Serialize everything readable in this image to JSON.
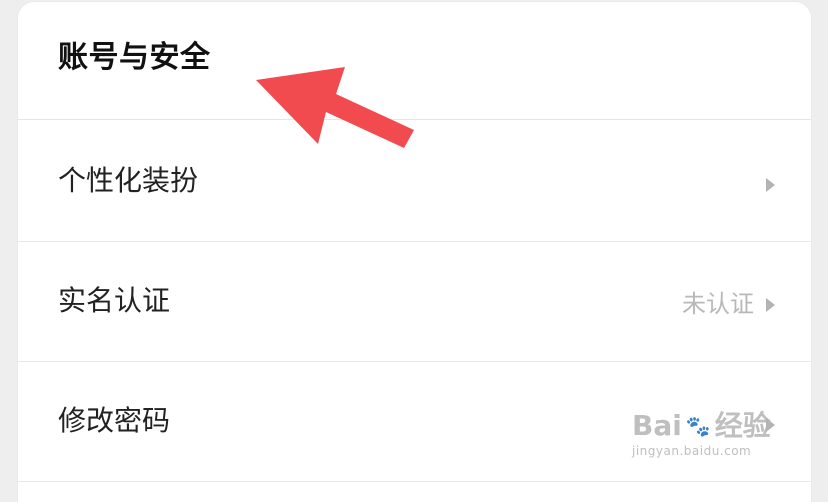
{
  "header": {
    "title": "账号与安全"
  },
  "rows": [
    {
      "label": "个性化装扮",
      "status": ""
    },
    {
      "label": "实名认证",
      "status": "未认证"
    },
    {
      "label": "修改密码",
      "status": ""
    }
  ],
  "watermark": {
    "brand_text": "Bai",
    "paw_glyph": "🐾",
    "suffix": "经验",
    "url": "jingyan.baidu.com"
  },
  "colors": {
    "background": "#eeeeee",
    "card": "#ffffff",
    "arrow": "#f24b4f",
    "status_text": "#b8b8b8",
    "chevron": "#b3b3b3"
  },
  "icons": {
    "chevron": "chevron-right-icon",
    "arrow": "annotation-arrow-icon",
    "watermark_paw": "paw-icon"
  }
}
